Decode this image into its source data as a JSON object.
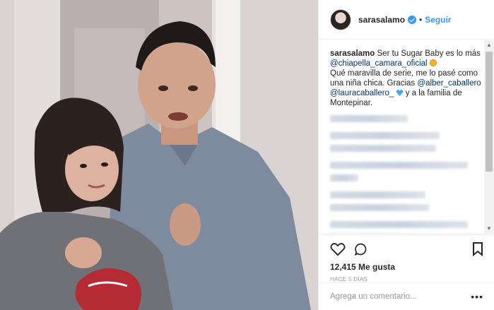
{
  "header": {
    "username": "sarasalamo",
    "separator": "•",
    "follow_label": "Seguir"
  },
  "caption": {
    "username": "sarasalamo",
    "text_1": "Ser tu Sugar Baby es lo más",
    "mention_1": "@chiapella_camara_oficial",
    "text_2": "Qué maravilla de serie, me lo pasé como una niña chica. Gracias",
    "mention_2": "@alber_caballero",
    "mention_3": "@lauracaballero_",
    "text_3": "y a la familia de Montepinar."
  },
  "post": {
    "likes": "12,415 Me gusta",
    "time": "HACE 5 DÍAS"
  },
  "comment_box": {
    "placeholder": "Agrega un comentario...",
    "more": "•••"
  },
  "icons": {
    "like": "heart-icon",
    "comment": "comment-icon",
    "save": "bookmark-icon",
    "verified": "verified-badge-icon"
  },
  "colors": {
    "link": "#3897f0",
    "mention": "#003569",
    "text": "#262626",
    "muted": "#999999"
  }
}
